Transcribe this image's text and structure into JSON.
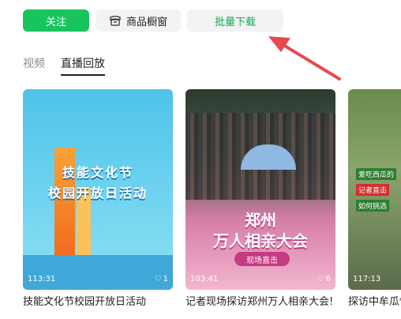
{
  "actions": {
    "follow_label": "关注",
    "shop_label": "商品橱窗",
    "batch_download_label": "批量下载"
  },
  "tabs": [
    {
      "label": "视频",
      "active": false
    },
    {
      "label": "直播回放",
      "active": true
    }
  ],
  "cards": [
    {
      "duration": "113:31",
      "likes": "1",
      "title": "技能文化节校园开放日活动",
      "thumb_text_line1": "技能文化节",
      "thumb_text_line2": "校园开放日活动"
    },
    {
      "duration": "103:41",
      "likes": "6",
      "title": "记者现场探访郑州万人相亲大会!",
      "thumb_text_line1": "郑州",
      "thumb_text_line2": "万人相亲大会",
      "thumb_badge": "现场直击"
    },
    {
      "duration": "117:13",
      "likes": "",
      "title": "探访中牟瓜情",
      "thumb_text_line1": "爱吃西瓜的",
      "thumb_text_line2": "记者直击",
      "thumb_text_line3": "如何挑选"
    }
  ],
  "colors": {
    "accent_green": "#18c45c",
    "batch_text_green": "#18a853",
    "arrow_red": "#e8484f"
  },
  "icons": {
    "shop": "shop-window-icon",
    "like": "heart-icon",
    "annotation": "red-arrow"
  }
}
